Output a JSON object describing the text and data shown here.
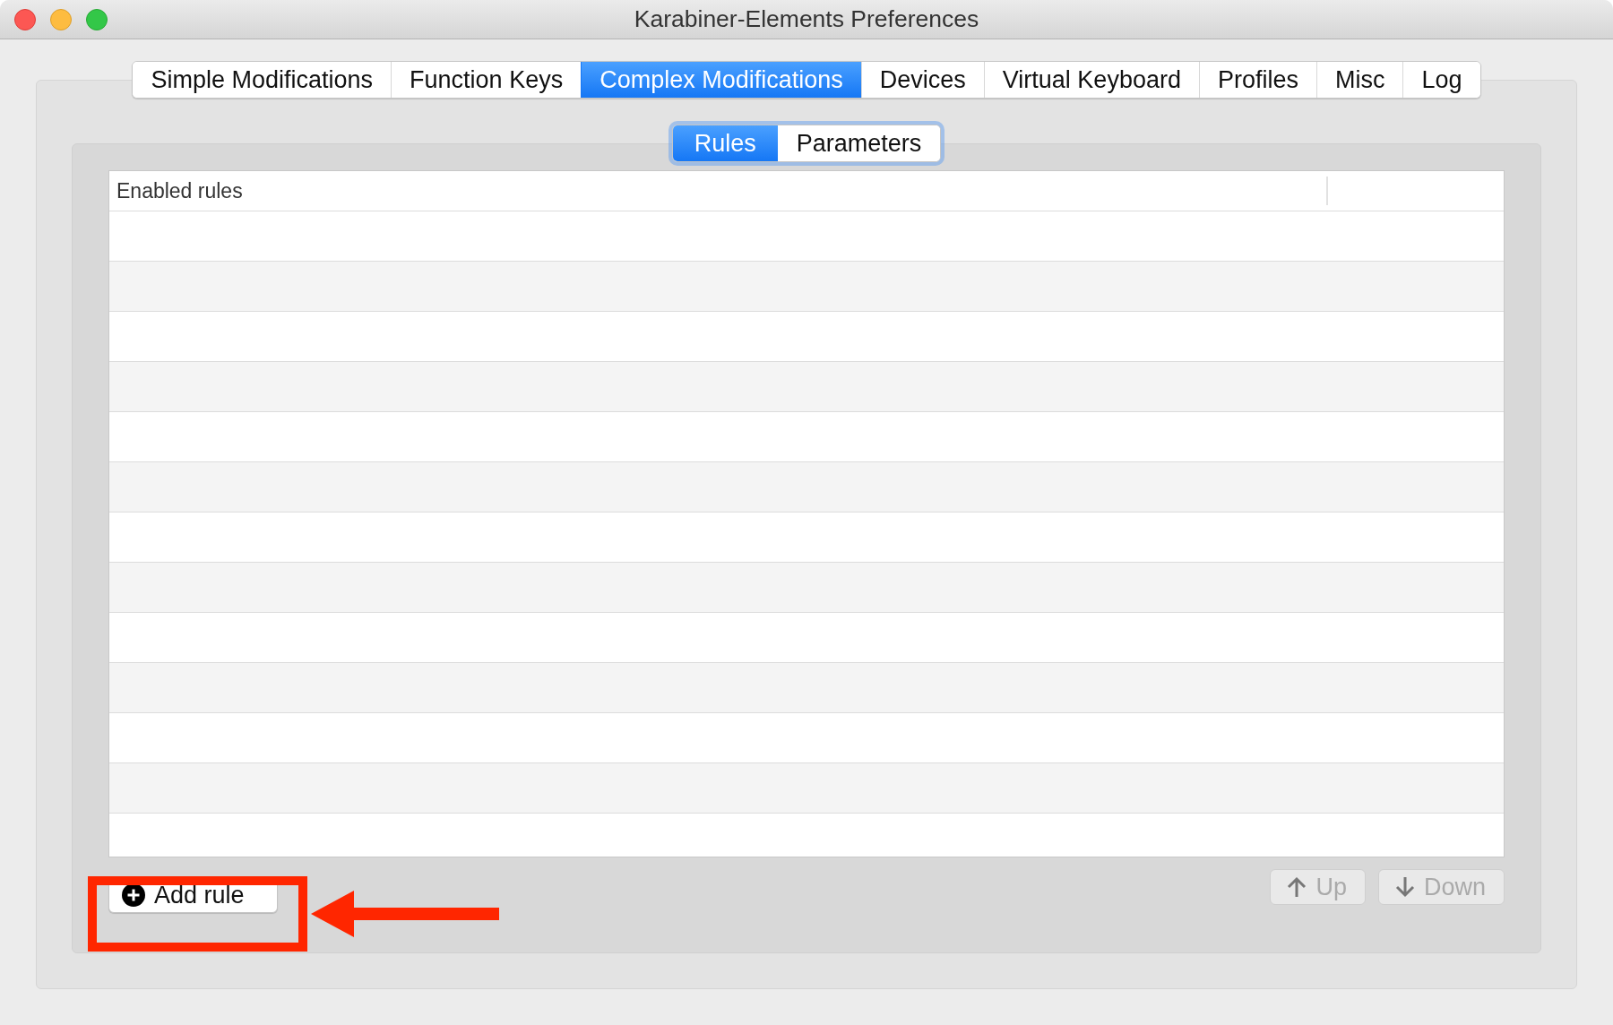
{
  "window": {
    "title": "Karabiner-Elements Preferences"
  },
  "tabs": [
    {
      "label": "Simple Modifications",
      "selected": false
    },
    {
      "label": "Function Keys",
      "selected": false
    },
    {
      "label": "Complex Modifications",
      "selected": true
    },
    {
      "label": "Devices",
      "selected": false
    },
    {
      "label": "Virtual Keyboard",
      "selected": false
    },
    {
      "label": "Profiles",
      "selected": false
    },
    {
      "label": "Misc",
      "selected": false
    },
    {
      "label": "Log",
      "selected": false
    }
  ],
  "subtabs": [
    {
      "label": "Rules",
      "selected": true
    },
    {
      "label": "Parameters",
      "selected": false
    }
  ],
  "table": {
    "columns": [
      {
        "label": "Enabled rules"
      }
    ]
  },
  "buttons": [
    {
      "kind": "add",
      "label": "Add rule",
      "disabled": false
    },
    {
      "kind": "up",
      "label": "Up",
      "disabled": true
    },
    {
      "kind": "down",
      "label": "Down",
      "disabled": true
    }
  ]
}
